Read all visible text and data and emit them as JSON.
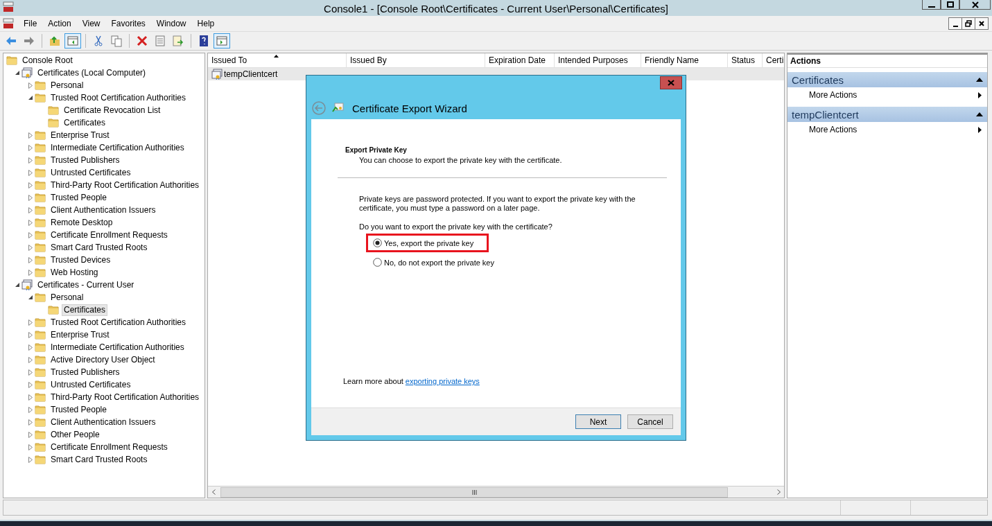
{
  "window": {
    "title": "Console1 - [Console Root\\Certificates - Current User\\Personal\\Certificates]"
  },
  "menu": [
    "File",
    "Action",
    "View",
    "Favorites",
    "Window",
    "Help"
  ],
  "toolbar": [
    {
      "kind": "back",
      "on": false
    },
    {
      "kind": "forward",
      "on": false
    },
    {
      "kind": "up",
      "on": false
    },
    {
      "kind": "tree",
      "on": true
    },
    {
      "kind": "cut",
      "on": false
    },
    {
      "kind": "copy",
      "on": false
    },
    {
      "kind": "delete",
      "on": false
    },
    {
      "kind": "properties",
      "on": false
    },
    {
      "kind": "export",
      "on": false
    },
    {
      "kind": "help",
      "on": false
    },
    {
      "kind": "actions",
      "on": true
    }
  ],
  "tree": [
    {
      "label": "Console Root",
      "kind": "root",
      "selected": false,
      "children": [
        {
          "label": "Certificates (Local Computer)",
          "kind": "store",
          "expanded": true,
          "selected": false,
          "children": [
            {
              "label": "Personal",
              "kind": "folder",
              "expanded": false,
              "selected": false
            },
            {
              "label": "Trusted Root Certification Authorities",
              "kind": "folder",
              "expanded": true,
              "selected": false,
              "children": [
                {
                  "label": "Certificate Revocation List",
                  "kind": "leaf",
                  "selected": false
                },
                {
                  "label": "Certificates",
                  "kind": "leaf",
                  "selected": false
                }
              ]
            },
            {
              "label": "Enterprise Trust",
              "kind": "folder",
              "expanded": false,
              "selected": false
            },
            {
              "label": "Intermediate Certification Authorities",
              "kind": "folder",
              "expanded": false,
              "selected": false
            },
            {
              "label": "Trusted Publishers",
              "kind": "folder",
              "expanded": false,
              "selected": false
            },
            {
              "label": "Untrusted Certificates",
              "kind": "folder",
              "expanded": false,
              "selected": false
            },
            {
              "label": "Third-Party Root Certification Authorities",
              "kind": "folder",
              "expanded": false,
              "selected": false
            },
            {
              "label": "Trusted People",
              "kind": "folder",
              "expanded": false,
              "selected": false
            },
            {
              "label": "Client Authentication Issuers",
              "kind": "folder",
              "expanded": false,
              "selected": false
            },
            {
              "label": "Remote Desktop",
              "kind": "folder",
              "expanded": false,
              "selected": false
            },
            {
              "label": "Certificate Enrollment Requests",
              "kind": "folder",
              "expanded": false,
              "selected": false
            },
            {
              "label": "Smart Card Trusted Roots",
              "kind": "folder",
              "expanded": false,
              "selected": false
            },
            {
              "label": "Trusted Devices",
              "kind": "folder",
              "expanded": false,
              "selected": false
            },
            {
              "label": "Web Hosting",
              "kind": "folder",
              "expanded": false,
              "selected": false
            }
          ]
        },
        {
          "label": "Certificates - Current User",
          "kind": "store",
          "expanded": true,
          "selected": false,
          "children": [
            {
              "label": "Personal",
              "kind": "folder",
              "expanded": true,
              "selected": false,
              "children": [
                {
                  "label": "Certificates",
                  "kind": "leaf",
                  "selected": true
                }
              ]
            },
            {
              "label": "Trusted Root Certification Authorities",
              "kind": "folder",
              "expanded": false,
              "selected": false
            },
            {
              "label": "Enterprise Trust",
              "kind": "folder",
              "expanded": false,
              "selected": false
            },
            {
              "label": "Intermediate Certification Authorities",
              "kind": "folder",
              "expanded": false,
              "selected": false
            },
            {
              "label": "Active Directory User Object",
              "kind": "folder",
              "expanded": false,
              "selected": false
            },
            {
              "label": "Trusted Publishers",
              "kind": "folder",
              "expanded": false,
              "selected": false
            },
            {
              "label": "Untrusted Certificates",
              "kind": "folder",
              "expanded": false,
              "selected": false
            },
            {
              "label": "Third-Party Root Certification Authorities",
              "kind": "folder",
              "expanded": false,
              "selected": false
            },
            {
              "label": "Trusted People",
              "kind": "folder",
              "expanded": false,
              "selected": false
            },
            {
              "label": "Client Authentication Issuers",
              "kind": "folder",
              "expanded": false,
              "selected": false
            },
            {
              "label": "Other People",
              "kind": "folder",
              "expanded": false,
              "selected": false
            },
            {
              "label": "Certificate Enrollment Requests",
              "kind": "folder",
              "expanded": false,
              "selected": false
            },
            {
              "label": "Smart Card Trusted Roots",
              "kind": "folder",
              "expanded": false,
              "selected": false
            }
          ]
        }
      ]
    }
  ],
  "list": {
    "columns": [
      {
        "label": "Issued To",
        "sorted": true
      },
      {
        "label": "Issued By",
        "sorted": false
      },
      {
        "label": "Expiration Date",
        "sorted": false
      },
      {
        "label": "Intended Purposes",
        "sorted": false
      },
      {
        "label": "Friendly Name",
        "sorted": false
      },
      {
        "label": "Status",
        "sorted": false
      },
      {
        "label": "Certi",
        "sorted": false
      }
    ],
    "rows": [
      {
        "cells": [
          "tempClientcert"
        ],
        "selected": true
      }
    ]
  },
  "actions": {
    "title": "Actions",
    "sections": [
      {
        "title": "Certificates",
        "expanded": true,
        "items": [
          "More Actions"
        ]
      },
      {
        "title": "tempClientcert",
        "expanded": true,
        "items": [
          "More Actions"
        ]
      }
    ]
  },
  "dialog": {
    "title": "Certificate Export Wizard",
    "heading": "Export Private Key",
    "subheading": "You can choose to export the private key with the certificate.",
    "paragraph": "Private keys are password protected. If you want to export the private key with the certificate, you must type a password on a later page.",
    "question": "Do you want to export the private key with the certificate?",
    "options": [
      {
        "label": "Yes, export the private key",
        "selected": true,
        "highlighted": true
      },
      {
        "label": "No, do not export the private key",
        "selected": false,
        "highlighted": false
      }
    ],
    "learn_more": {
      "text": "Learn more about",
      "link": "exporting private keys"
    },
    "buttons": [
      {
        "label": "Next",
        "default": true
      },
      {
        "label": "Cancel",
        "default": false
      }
    ]
  }
}
